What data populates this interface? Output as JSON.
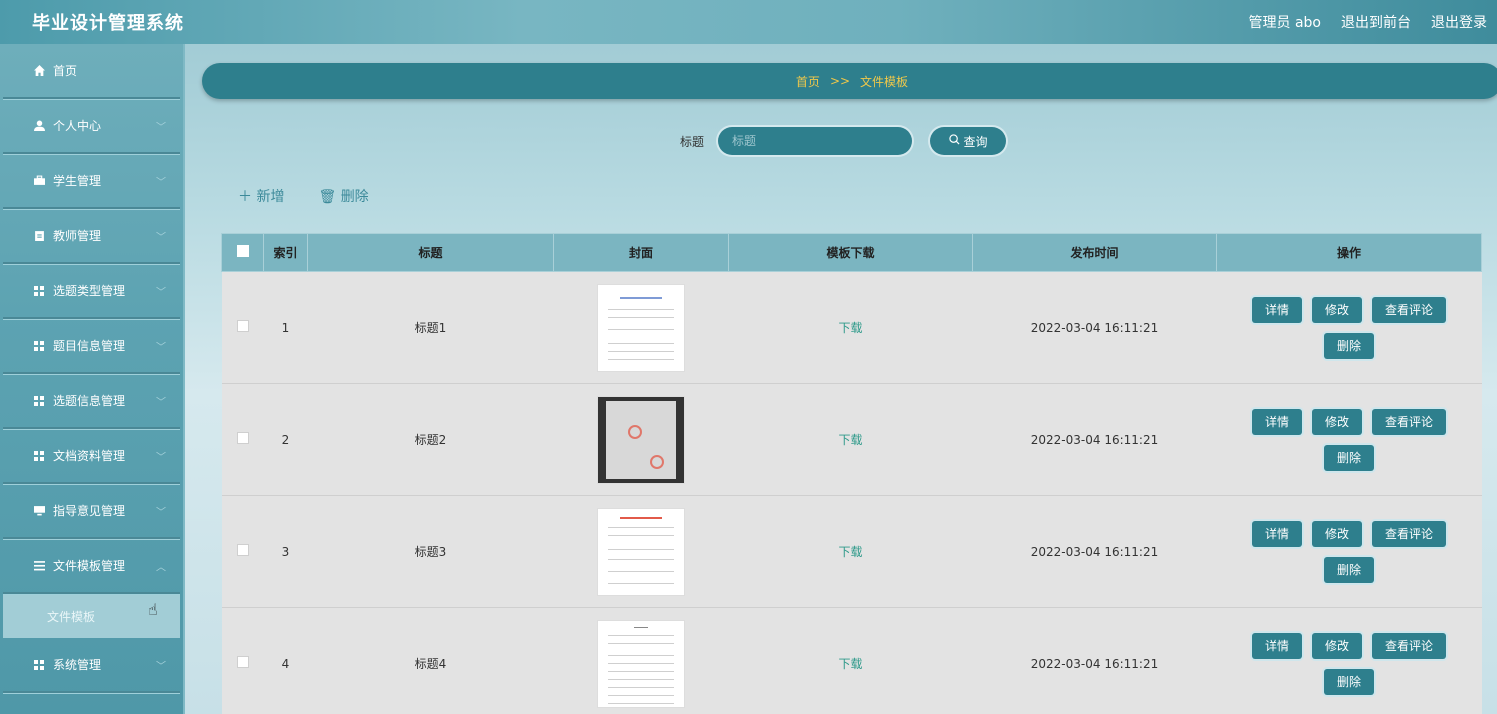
{
  "header": {
    "title": "毕业设计管理系统",
    "user": "管理员 abo",
    "exit_front": "退出到前台",
    "logout": "退出登录"
  },
  "sidebar": {
    "items": [
      {
        "label": "首页",
        "icon": "home-icon"
      },
      {
        "label": "个人中心",
        "icon": "person-icon"
      },
      {
        "label": "学生管理",
        "icon": "briefcase-icon"
      },
      {
        "label": "教师管理",
        "icon": "clipboard-icon"
      },
      {
        "label": "选题类型管理",
        "icon": "grid-icon"
      },
      {
        "label": "题目信息管理",
        "icon": "grid-icon"
      },
      {
        "label": "选题信息管理",
        "icon": "grid-icon"
      },
      {
        "label": "文档资料管理",
        "icon": "grid-icon"
      },
      {
        "label": "指导意见管理",
        "icon": "monitor-icon"
      },
      {
        "label": "文件模板管理",
        "icon": "list-icon"
      }
    ],
    "sub_item": "文件模板",
    "last_item": {
      "label": "系统管理",
      "icon": "grid-icon"
    }
  },
  "breadcrumb": {
    "home": "首页",
    "sep": ">>",
    "current": "文件模板"
  },
  "search": {
    "label": "标题",
    "placeholder": "标题",
    "button": "查询"
  },
  "actions": {
    "add": "新增",
    "delete": "删除"
  },
  "table": {
    "headers": [
      "索引",
      "标题",
      "封面",
      "模板下载",
      "发布时间",
      "操作"
    ],
    "rows": [
      {
        "index": "1",
        "title": "标题1",
        "download": "下载",
        "time": "2022-03-04 16:11:21"
      },
      {
        "index": "2",
        "title": "标题2",
        "download": "下载",
        "time": "2022-03-04 16:11:21"
      },
      {
        "index": "3",
        "title": "标题3",
        "download": "下载",
        "time": "2022-03-04 16:11:21"
      },
      {
        "index": "4",
        "title": "标题4",
        "download": "下载",
        "time": "2022-03-04 16:11:21"
      }
    ],
    "ops": {
      "detail": "详情",
      "edit": "修改",
      "comments": "查看评论",
      "delete": "删除"
    }
  }
}
